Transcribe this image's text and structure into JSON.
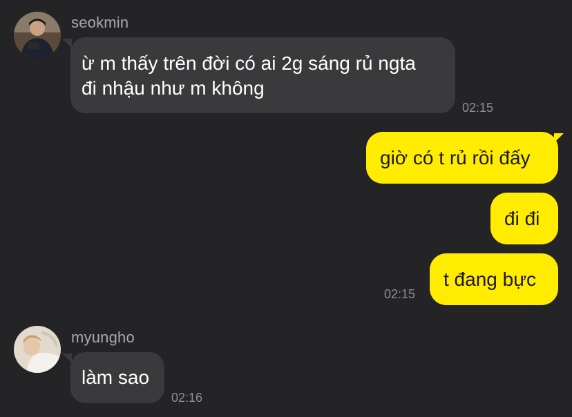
{
  "messages": [
    {
      "sender": "seokmin",
      "avatar_icon": "person-photo-avatar-icon",
      "text": "ừ m thấy trên đời có ai 2g sáng rủ ngta\nđi nhậu như m không",
      "time": "02:15",
      "direction": "incoming"
    },
    {
      "text": "giờ có t rủ rồi đấy",
      "direction": "outgoing"
    },
    {
      "text": "đi đi",
      "direction": "outgoing"
    },
    {
      "text": "t đang bực",
      "time": "02:15",
      "direction": "outgoing"
    },
    {
      "sender": "myungho",
      "avatar_icon": "person-photo-avatar-icon",
      "text": "làm sao",
      "time": "02:16",
      "direction": "incoming"
    }
  ],
  "colors": {
    "background": "#242426",
    "incoming_bubble": "#3a3a3c",
    "outgoing_bubble": "#ffec00",
    "timestamp": "#8e8e93",
    "sender_name": "#a9a9ac"
  }
}
